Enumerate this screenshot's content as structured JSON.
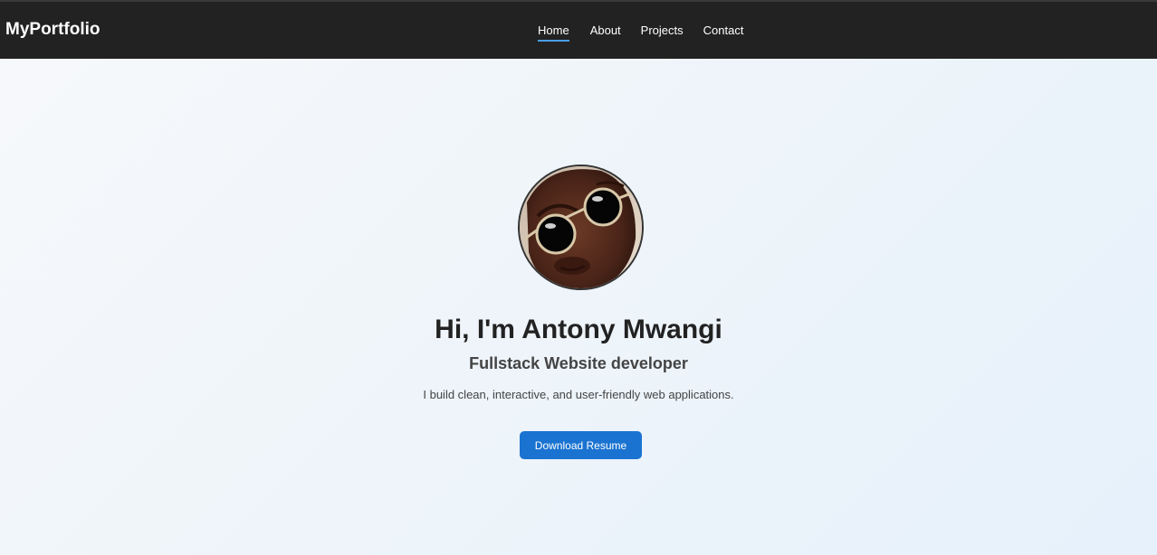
{
  "navbar": {
    "brand": "MyPortfolio",
    "links": [
      {
        "label": "Home",
        "active": true
      },
      {
        "label": "About",
        "active": false
      },
      {
        "label": "Projects",
        "active": false
      },
      {
        "label": "Contact",
        "active": false
      }
    ],
    "accent_color": "#4a9fe6",
    "background_color": "#222222"
  },
  "hero": {
    "avatar_icon": "profile-photo",
    "title": "Hi, I'm Antony Mwangi",
    "subtitle": "Fullstack Website developer",
    "description": "I build clean, interactive, and user-friendly web applications.",
    "cta_label": "Download Resume",
    "cta_color": "#1a73d1"
  }
}
